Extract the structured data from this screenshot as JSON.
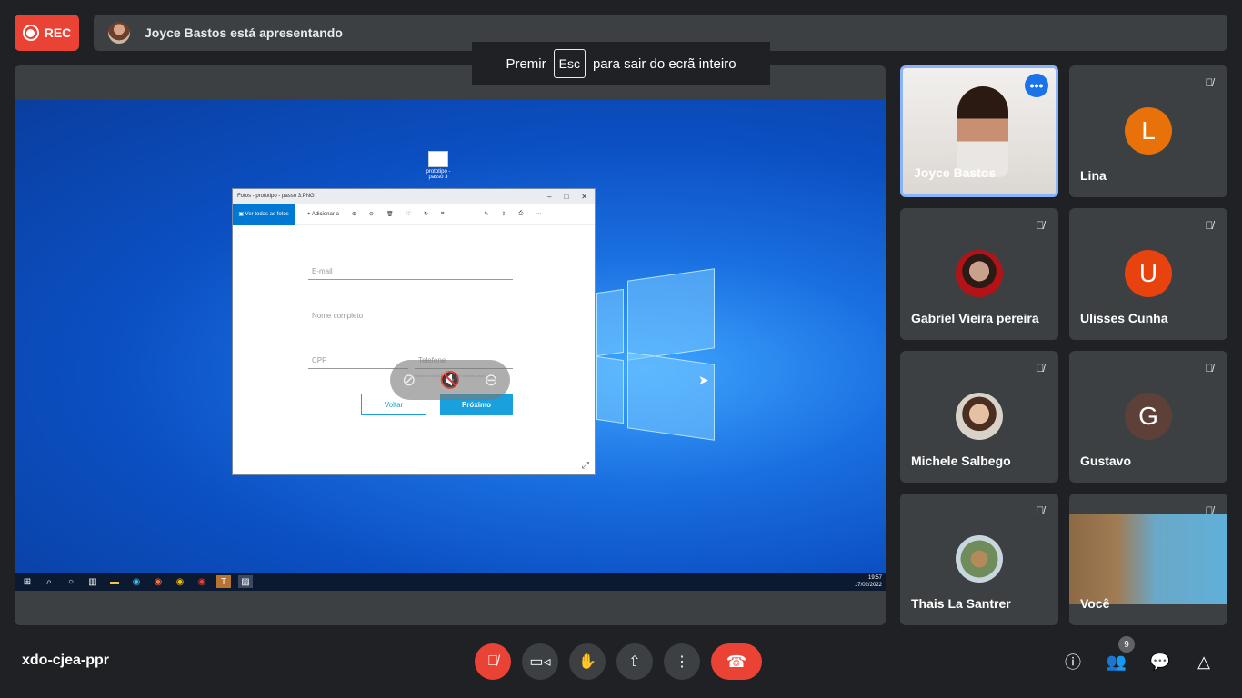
{
  "top": {
    "rec_label": "REC",
    "presenter_text": "Joyce Bastos está apresentando",
    "esc_tip": {
      "before": "Premir",
      "key": "Esc",
      "after": "para sair do ecrã inteiro"
    }
  },
  "screen_share": {
    "desktop_icon_label": "prototipo - passo 3",
    "window": {
      "title": "Fotos - prototipo - passo 3.PNG",
      "toolbar": {
        "all_photos": "Ver todas as fotos",
        "add_to": "Adicionar a"
      },
      "form": {
        "email_placeholder": "E-mail",
        "name_placeholder": "Nome completo",
        "cpf_placeholder": "CPF",
        "phone_placeholder": "Telefone",
        "phone_hint": "Número com DDD e dígito 9 no início, caso houver",
        "back_label": "Voltar",
        "next_label": "Próximo"
      }
    },
    "taskbar": {
      "time": "19:57",
      "date": "17/02/2022"
    }
  },
  "participants": [
    {
      "name": "Joyce Bastos",
      "kind": "video",
      "menu_icon": "more-icon"
    },
    {
      "name": "Lina",
      "kind": "letter",
      "letter": "L",
      "color": "#e8710a",
      "muted": true
    },
    {
      "name": "Gabriel Vieira pereira",
      "kind": "photo",
      "muted": true
    },
    {
      "name": "Ulisses Cunha",
      "kind": "letter",
      "letter": "U",
      "color": "#e8430f",
      "muted": true
    },
    {
      "name": "Michele Salbego",
      "kind": "photo",
      "muted": true
    },
    {
      "name": "Gustavo",
      "kind": "letter",
      "letter": "G",
      "color": "#5d4037",
      "muted": true
    },
    {
      "name": "Thais La Santrer",
      "kind": "photo",
      "muted": true
    },
    {
      "name": "Você",
      "kind": "video",
      "muted": true
    }
  ],
  "bottom": {
    "meeting_code": "xdo-cjea-ppr",
    "people_count": "9"
  },
  "colors": {
    "accent_red": "#ea4335",
    "tile_bg": "#3c4043",
    "page_bg": "#202124",
    "highlight": "#8ab4f8"
  }
}
